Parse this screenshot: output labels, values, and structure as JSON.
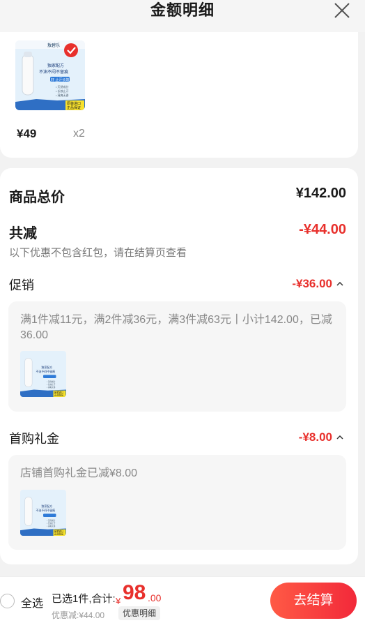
{
  "header": {
    "title": "金额明细"
  },
  "product": {
    "price": "¥49",
    "quantity": "x2",
    "image_texts": {
      "top": "敖碧乐",
      "line1": "独家配方",
      "line2": "不油不闷不留痕",
      "line3": "好 止汗长效",
      "b1": "• 天然成分",
      "b2": "• 长效止汗",
      "b3": "• 清爽无香",
      "badge1": "原装进口",
      "badge2": "正品保证"
    }
  },
  "summary": {
    "total_label": "商品总价",
    "total_value": "¥142.00",
    "reduction_label": "共减",
    "reduction_value": "-¥44.00",
    "note": "以下优惠不包含红包，请在结算页查看"
  },
  "promotion": {
    "label": "促销",
    "value": "-¥36.00",
    "detail": "满1件减11元，满2件减36元，满3件减63元丨小计142.00，已减36.00"
  },
  "gift": {
    "label": "首购礼金",
    "value": "-¥8.00",
    "detail": "店铺首购礼金已减¥8.00"
  },
  "bottom": {
    "select_all": "全选",
    "selected_summary": "已选1件,合计:",
    "currency": "¥",
    "total_int": "98",
    "total_dec": ".00",
    "discount_text": "优惠减:¥44.00",
    "detail_tag": "优惠明细",
    "checkout": "去结算"
  },
  "colors": {
    "accent": "#e8302c",
    "checkout_start": "#ff5a45",
    "checkout_end": "#f2293a"
  }
}
